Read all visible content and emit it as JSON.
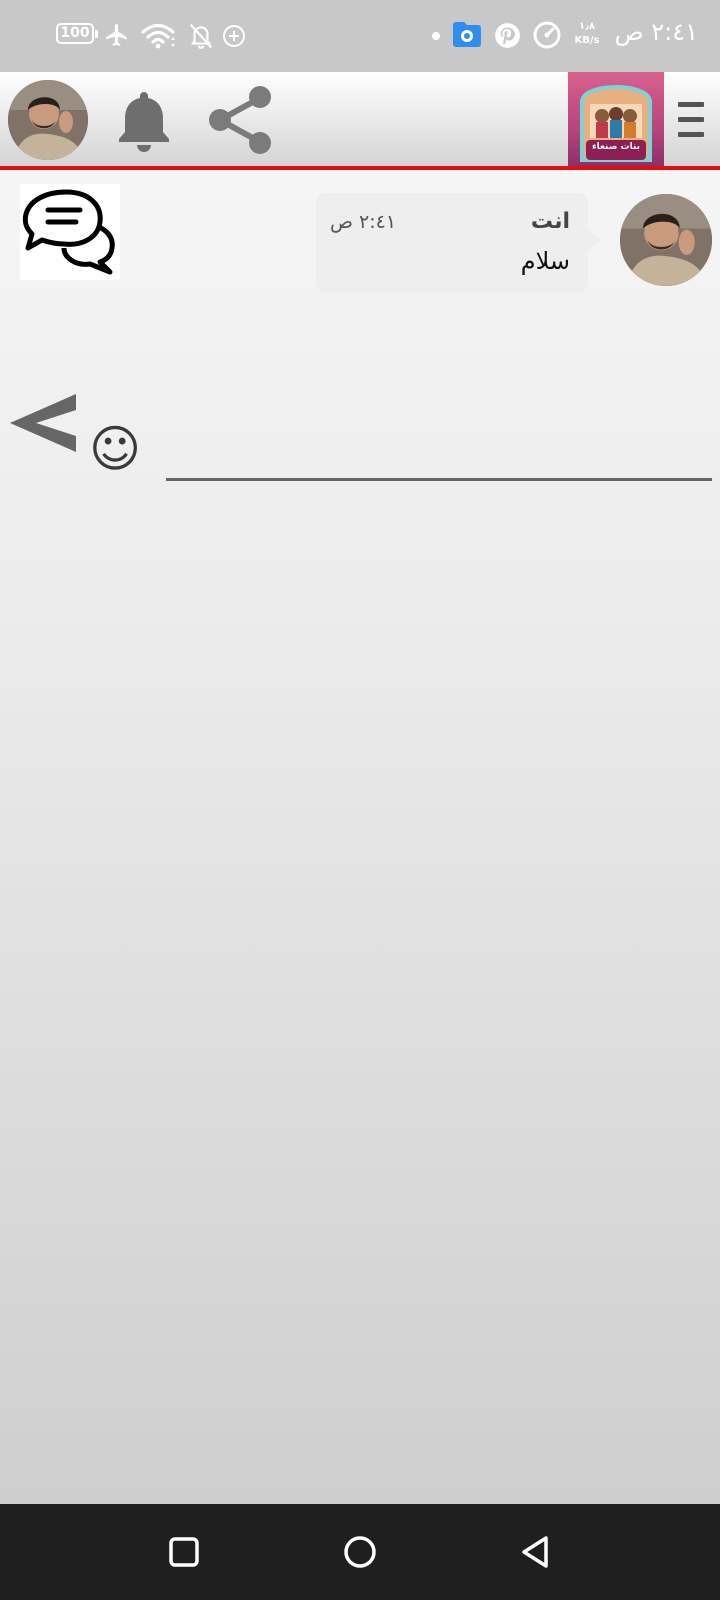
{
  "status_bar": {
    "time": "٢:٤١ ص",
    "battery": "100",
    "net_speed_value": "١٫٨",
    "net_speed_unit": "KB/s"
  },
  "header": {
    "menu_icon": "hamburger-menu-icon",
    "bell_icon": "bell-icon",
    "share_icon": "share-icon",
    "banner_label": "بنات صنعاء"
  },
  "chat": {
    "messages": [
      {
        "sender": "انت",
        "time": "٢:٤١ ص",
        "text": "سلام"
      }
    ],
    "badge_icon": "chat-bubbles-icon"
  },
  "composer": {
    "input_value": "",
    "send_icon": "send-icon",
    "emoji_icon": "emoji-icon",
    "emoji_glyph": "☺"
  },
  "colors": {
    "accent_line": "#e01010",
    "header_gray": "#d4d4d4",
    "icon_gray": "#777777"
  }
}
